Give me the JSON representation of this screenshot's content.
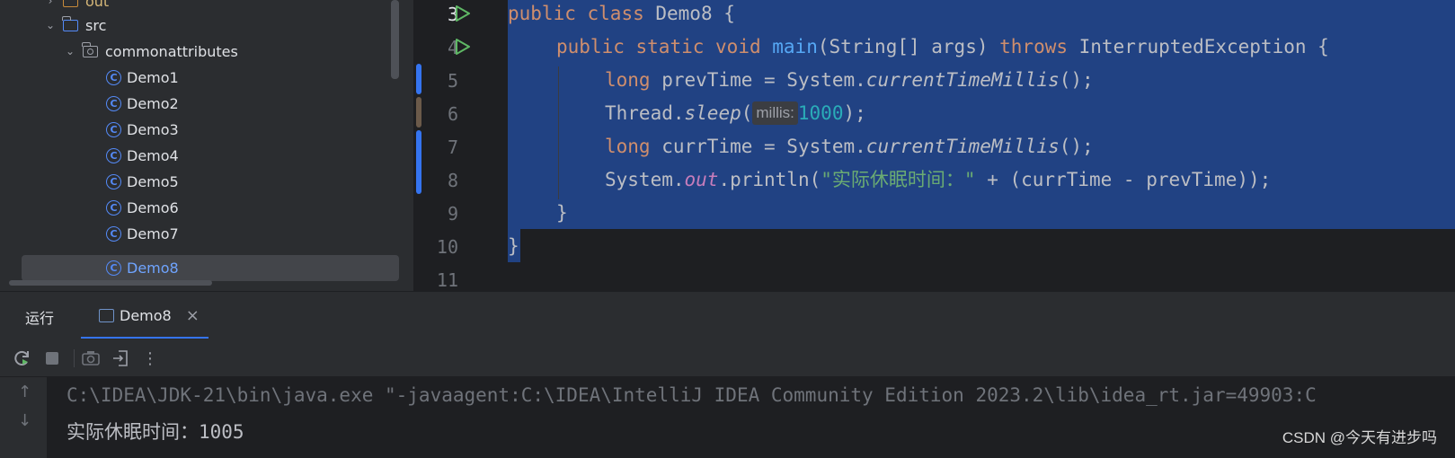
{
  "project_tree": {
    "items": [
      {
        "label": "out",
        "kind": "folder",
        "expanded": false
      },
      {
        "label": "src",
        "kind": "folder",
        "expanded": true
      },
      {
        "label": "commonattributes",
        "kind": "package",
        "expanded": true
      },
      {
        "label": "Demo1",
        "kind": "class"
      },
      {
        "label": "Demo2",
        "kind": "class"
      },
      {
        "label": "Demo3",
        "kind": "class"
      },
      {
        "label": "Demo4",
        "kind": "class"
      },
      {
        "label": "Demo5",
        "kind": "class"
      },
      {
        "label": "Demo6",
        "kind": "class"
      },
      {
        "label": "Demo7",
        "kind": "class"
      },
      {
        "label": "Demo8",
        "kind": "class",
        "selected": true
      }
    ],
    "class_icon_letter": "C"
  },
  "editor": {
    "lines": [
      {
        "num": "3"
      },
      {
        "num": "4"
      },
      {
        "num": "5"
      },
      {
        "num": "6"
      },
      {
        "num": "7"
      },
      {
        "num": "8"
      },
      {
        "num": "9"
      },
      {
        "num": "10"
      },
      {
        "num": "11"
      }
    ],
    "code": {
      "l3": {
        "kw1": "public",
        "kw2": "class",
        "rest": " Demo8 {"
      },
      "l4": {
        "kw1": "public",
        "kw2": "static",
        "kw3": "void",
        "fn": "main",
        "params": "(String[] args) ",
        "kw4": "throws",
        "rest": " InterruptedException {"
      },
      "l5": {
        "kw": "long",
        "a": " prevTime = System.",
        "call": "currentTimeMillis",
        "b": "();"
      },
      "l6": {
        "a": "Thread.",
        "call": "sleep",
        "b": "(",
        "hint": "millis:",
        "num": "1000",
        "c": ");"
      },
      "l7": {
        "kw": "long",
        "a": " currTime = System.",
        "call": "currentTimeMillis",
        "b": "();"
      },
      "l8": {
        "a": "System.",
        "field": "out",
        "b": ".println(",
        "str": "\"实际休眠时间：\"",
        "c": " + (currTime - prevTime));"
      },
      "l9": {
        "a": "}"
      },
      "l10": {
        "a": "}"
      }
    },
    "colors": {
      "selection": "#214283",
      "keyword": "#cf8e6d",
      "function": "#56a8f5",
      "string": "#6aab73",
      "number": "#2aacb8",
      "static_field": "#c77dbb"
    }
  },
  "run_window": {
    "title": "运行",
    "tab_label": "Demo8",
    "close": "×",
    "toolbar": {
      "rerun": "rerun-icon",
      "stop": "stop-icon",
      "screenshot": "camera-icon",
      "exit": "exit-icon",
      "more": "⋮"
    },
    "console": {
      "command": "C:\\IDEA\\JDK-21\\bin\\java.exe \"-javaagent:C:\\IDEA\\IntelliJ IDEA Community Edition 2023.2\\lib\\idea_rt.jar=49903:C",
      "output": "实际休眠时间：1005",
      "up_arrow": "↑",
      "down_arrow": "↓"
    }
  },
  "watermark": "CSDN @今天有进步吗"
}
